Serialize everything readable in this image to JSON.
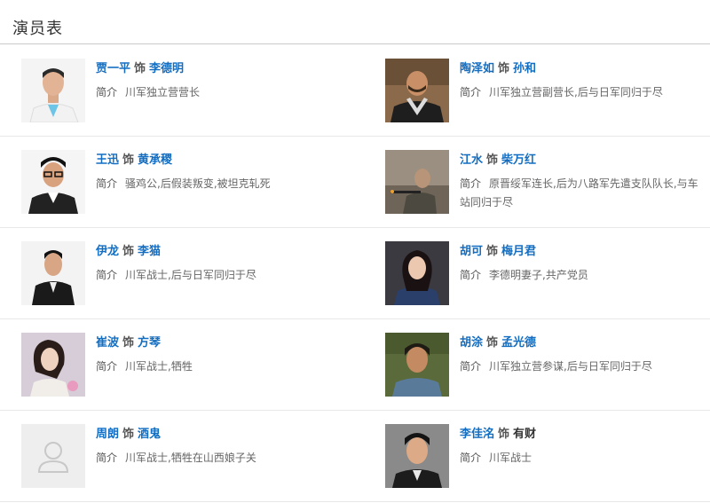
{
  "page": {
    "title": "演员表"
  },
  "intro_label": "简介",
  "as_label": "饰",
  "cast": [
    {
      "actor": "贾一平",
      "role": "李德明",
      "role_linked": true,
      "intro": "川军独立营营长",
      "photo": "portrait-white-suit",
      "has_photo": true
    },
    {
      "actor": "陶泽如",
      "role": "孙和",
      "role_linked": true,
      "intro": "川军独立营副营长,后与日军同归于尽",
      "photo": "portrait-scarf",
      "has_photo": true
    },
    {
      "actor": "王迅",
      "role": "黄承稷",
      "role_linked": true,
      "intro": "骚鸡公,后假装叛变,被坦克轧死",
      "photo": "portrait-glasses",
      "has_photo": true
    },
    {
      "actor": "江水",
      "role": "柴万红",
      "role_linked": true,
      "intro": "原晋绥军连长,后为八路军先遣支队队长,与车站同归于尽",
      "photo": "portrait-rifle",
      "has_photo": true
    },
    {
      "actor": "伊龙",
      "role": "李猫",
      "role_linked": true,
      "intro": "川军战士,后与日军同归于尽",
      "photo": "portrait-black-suit",
      "has_photo": true
    },
    {
      "actor": "胡可",
      "role": "梅月君",
      "role_linked": true,
      "intro": "李德明妻子,共产党员",
      "photo": "portrait-woman-blue",
      "has_photo": true
    },
    {
      "actor": "崔波",
      "role": "方琴",
      "role_linked": true,
      "intro": "川军战士,牺牲",
      "photo": "portrait-woman-flowers",
      "has_photo": true
    },
    {
      "actor": "胡涂",
      "role": "孟光德",
      "role_linked": true,
      "intro": "川军独立营参谋,后与日军同归于尽",
      "photo": "portrait-man-green",
      "has_photo": true
    },
    {
      "actor": "周朗",
      "role": "酒鬼",
      "role_linked": true,
      "intro": "川军战士,牺牲在山西娘子关",
      "photo": "placeholder-avatar",
      "has_photo": false
    },
    {
      "actor": "李佳洺",
      "role": "有财",
      "role_linked": false,
      "intro": "川军战士",
      "photo": "portrait-young-man",
      "has_photo": true
    }
  ],
  "colors": {
    "link": "#136ec2",
    "text": "#333333",
    "muted": "#666666",
    "divider": "#e8e8e8"
  }
}
